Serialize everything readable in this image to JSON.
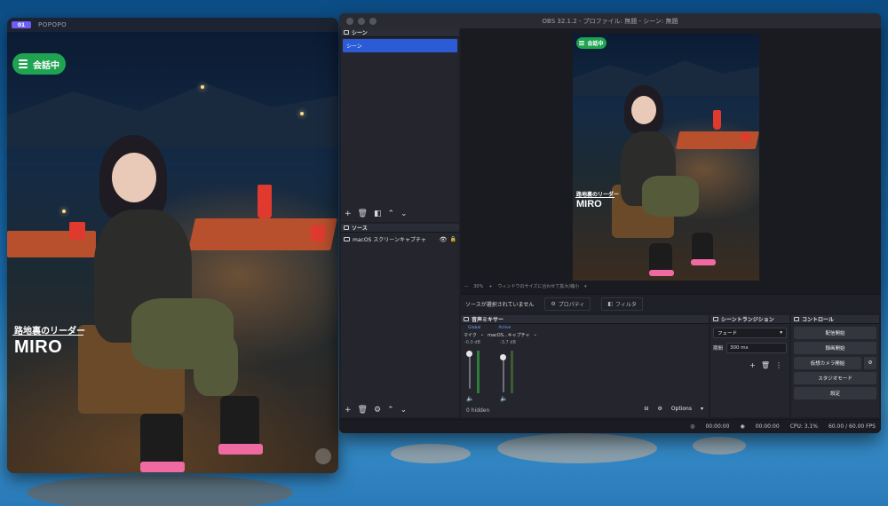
{
  "popopo": {
    "app_title": "POPOPO",
    "logo_text": "01",
    "talk_button": "会話中",
    "name_sub": "路地裏のリーダー",
    "name_main": "MIRO"
  },
  "obs": {
    "window_title": "OBS 32.1.2 - プロファイル: 無題 - シーン: 無題",
    "scenes": {
      "header": "シーン",
      "items": [
        "シーン"
      ]
    },
    "sources": {
      "header": "ソース",
      "items": [
        {
          "label": "macOS スクリーンキャプチャ"
        }
      ]
    },
    "preview": {
      "talk_button": "会話中",
      "name_sub": "路地裏のリーダー",
      "name_main": "MIRO",
      "zoom_minus": "−",
      "zoom_value": "30%",
      "zoom_plus": "+",
      "zoom_hint": "ウィンドウのサイズに合わせて拡大/縮小"
    },
    "selection_bar": {
      "no_source": "ソースが選択されていません",
      "properties": "プロパティ",
      "filters": "フィルタ"
    },
    "mixer": {
      "header": "音声ミキサー",
      "channels": [
        {
          "tag": "Global",
          "name": "マイク",
          "db": "-0.0 dB"
        },
        {
          "tag": "Active",
          "name": "macOS...キャプチャ",
          "db": "-3.7 dB"
        }
      ],
      "hidden_label": "0 hidden",
      "options": "Options"
    },
    "transitions": {
      "header": "シーントランジション",
      "selected": "フェード",
      "duration_label": "期間",
      "duration_value": "300 ms"
    },
    "controls": {
      "header": "コントロール",
      "buttons": [
        "配信開始",
        "録画開始",
        "仮想カメラ開始",
        "スタジオモード",
        "設定"
      ]
    },
    "status": {
      "stream_time": "00:00:00",
      "rec_time": "00:00:00",
      "cpu": "CPU: 3.1%",
      "fps": "60.00 / 60.00 FPS"
    }
  }
}
